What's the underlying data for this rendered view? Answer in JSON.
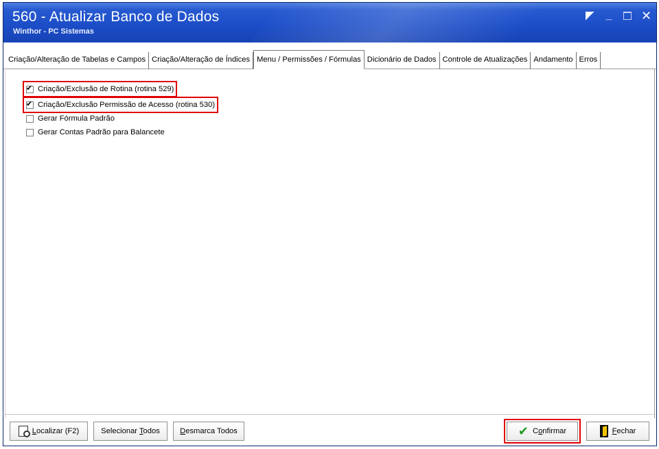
{
  "window": {
    "title": "560 - Atualizar Banco de Dados",
    "subtitle": "Winthor - PC Sistemas"
  },
  "tabs": [
    {
      "label": "Criação/Alteração de Tabelas e Campos",
      "active": false
    },
    {
      "label": "Criação/Alteração de Índices",
      "active": false
    },
    {
      "label": "Menu / Permissões / Fórmulas",
      "active": true
    },
    {
      "label": "Dicionário de Dados",
      "active": false
    },
    {
      "label": "Controle de Atualizações",
      "active": false
    },
    {
      "label": "Andamento",
      "active": false
    },
    {
      "label": "Erros",
      "active": false
    }
  ],
  "options": [
    {
      "label": "Criação/Exclusão de Rotina (rotina 529)",
      "checked": true
    },
    {
      "label": "Criação/Exclusão Permissão de Acesso (rotina 530)",
      "checked": true
    },
    {
      "label": "Gerar Fórmula Padrão",
      "checked": false
    },
    {
      "label": "Gerar Contas Padrão para Balancete",
      "checked": false
    }
  ],
  "buttons": {
    "localizar_pre": "",
    "localizar_u": "L",
    "localizar_post": "ocalizar (F2)",
    "selecionar_pre": "Selecionar ",
    "selecionar_u": "T",
    "selecionar_post": "odos",
    "desmarca_pre": "",
    "desmarca_u": "D",
    "desmarca_post": "esmarca Todos",
    "confirmar_pre": "C",
    "confirmar_u": "o",
    "confirmar_post": "nfirmar",
    "fechar_pre": "",
    "fechar_u": "F",
    "fechar_post": "echar"
  },
  "colors": {
    "titlebar": "#1c4ec8",
    "highlight": "#e00000",
    "confirm_icon": "#1f9a1f"
  }
}
